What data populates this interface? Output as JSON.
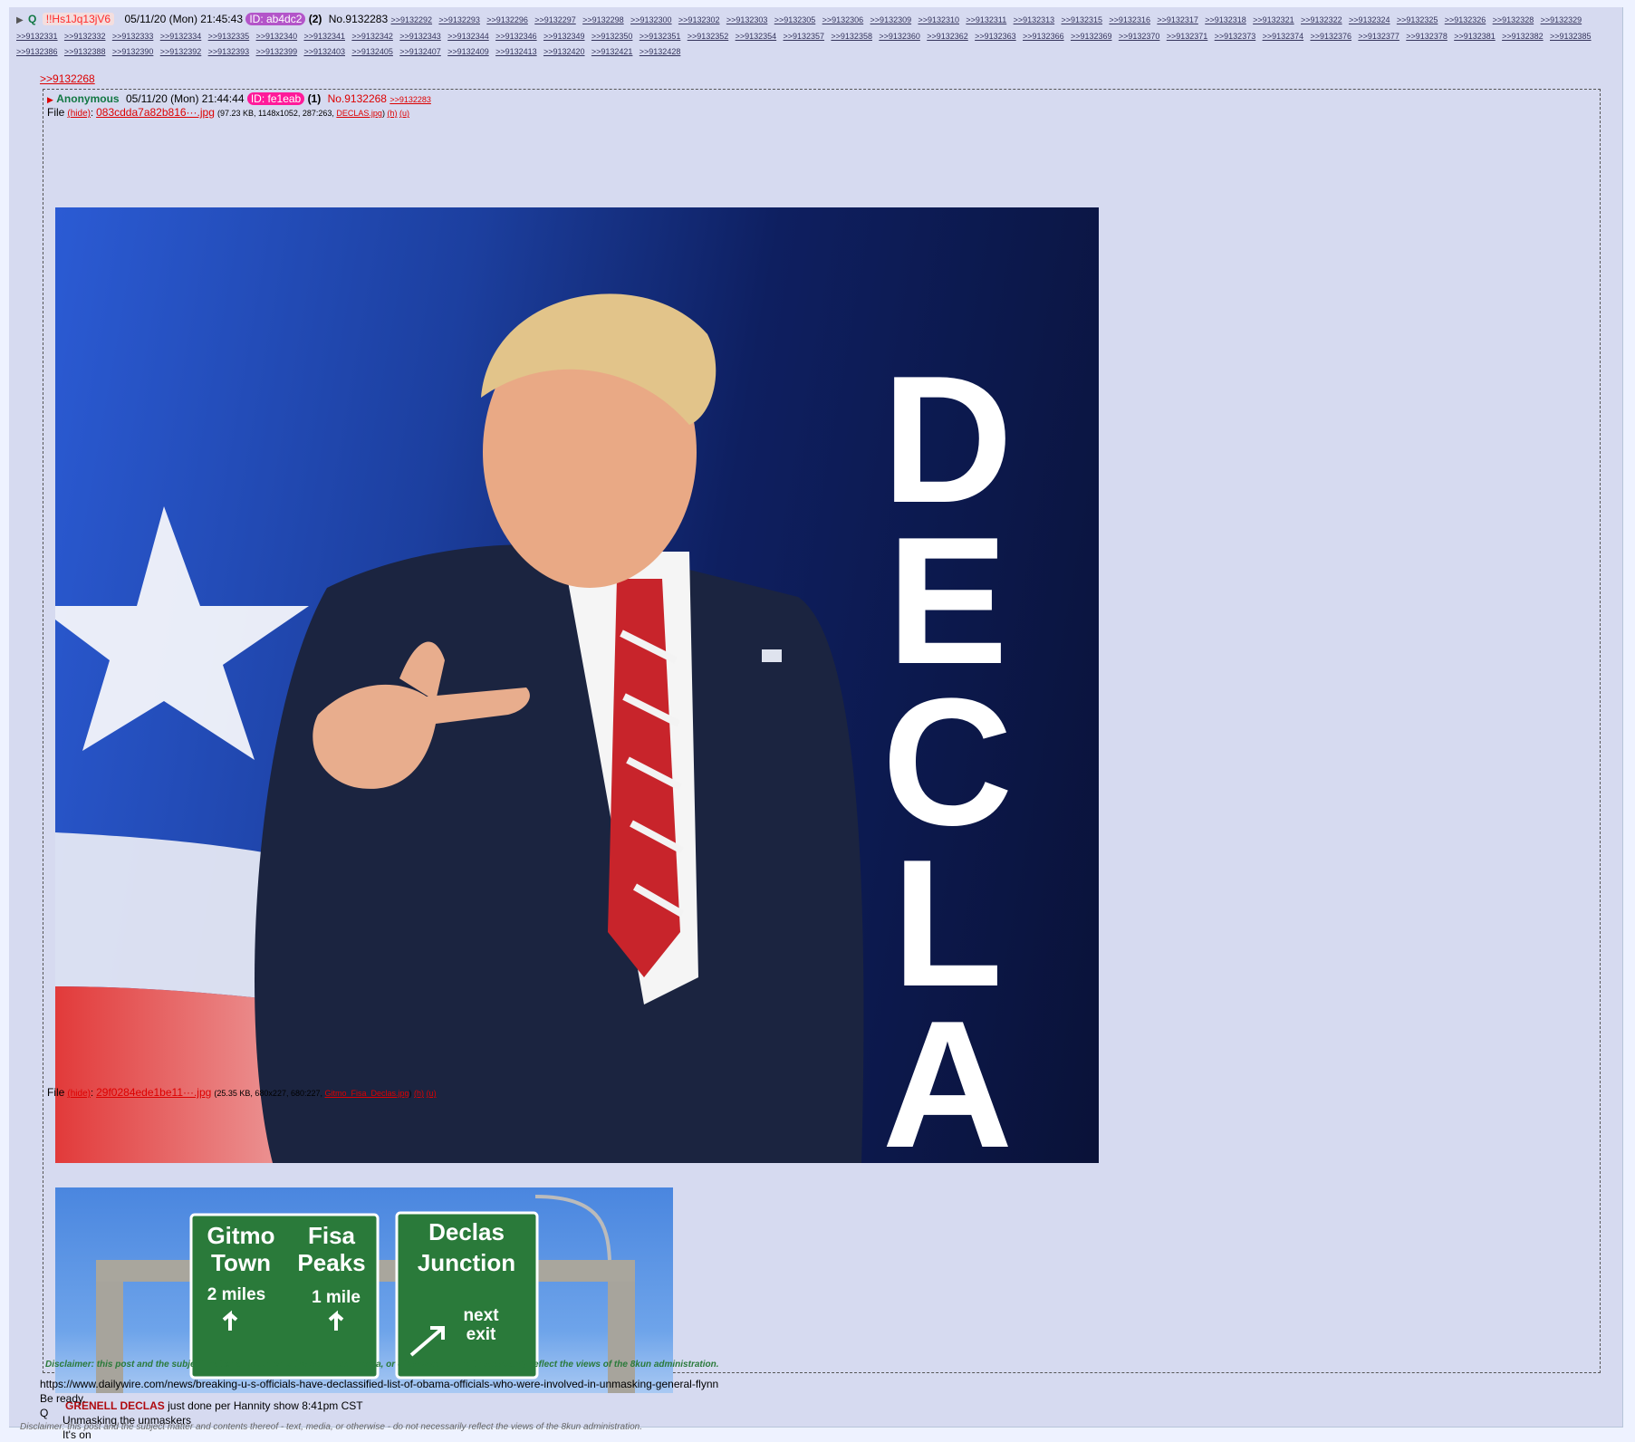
{
  "post": {
    "name": "Q",
    "tripcode": "!!Hs1Jq13jV6",
    "date": "05/11/20 (Mon) 21:45:43",
    "id": "ID: ab4dc2",
    "id_count": "(2)",
    "number": "No.9132283",
    "replies": [
      ">>9132292",
      ">>9132293",
      ">>9132296",
      ">>9132297",
      ">>9132298",
      ">>9132300",
      ">>9132302",
      ">>9132303",
      ">>9132305",
      ">>9132306",
      ">>9132309",
      ">>9132310",
      ">>9132311",
      ">>9132313",
      ">>9132315",
      ">>9132316",
      ">>9132317",
      ">>9132318",
      ">>9132321",
      ">>9132322",
      ">>9132324",
      ">>9132325",
      ">>9132326",
      ">>9132328",
      ">>9132329",
      ">>9132331",
      ">>9132332",
      ">>9132333",
      ">>9132334",
      ">>9132335",
      ">>9132340",
      ">>9132341",
      ">>9132342",
      ">>9132343",
      ">>9132344",
      ">>9132346",
      ">>9132349",
      ">>9132350",
      ">>9132351",
      ">>9132352",
      ">>9132354",
      ">>9132357",
      ">>9132358",
      ">>9132360",
      ">>9132362",
      ">>9132363",
      ">>9132366",
      ">>9132369",
      ">>9132370",
      ">>9132371",
      ">>9132373",
      ">>9132374",
      ">>9132376",
      ">>9132377",
      ">>9132378",
      ">>9132381",
      ">>9132382",
      ">>9132385",
      ">>9132386",
      ">>9132388",
      ">>9132390",
      ">>9132392",
      ">>9132393",
      ">>9132399",
      ">>9132403",
      ">>9132405",
      ">>9132407",
      ">>9132409",
      ">>9132413",
      ">>9132420",
      ">>9132421",
      ">>9132428"
    ],
    "quote_link": ">>9132268",
    "body_lines": [
      "https://www.dailywire.com/news/breaking-u-s-officials-have-declassified-list-of-obama-officials-who-were-involved-in-unmasking-general-flynn",
      "Be ready.",
      "Q"
    ],
    "disclaimer": "Disclaimer: this post and the subject matter and contents thereof - text, media, or otherwise - do not necessarily reflect the views of the 8kun administration."
  },
  "quoted": {
    "name": "Anonymous",
    "date": "05/11/20 (Mon) 21:44:44",
    "id": "ID: fe1eab",
    "id_count": "(1)",
    "number": "No.9132268",
    "backlink": ">>9132283",
    "files": [
      {
        "label": "File",
        "hide": "(hide)",
        "name": "083cdda7a82b816···.jpg",
        "meta_size": "(97.23 KB, 1148x1052, 287:263,",
        "orig_name": "DECLAS.jpg",
        "h": "(h)",
        "u": "(u)",
        "image_text": "DECLAS"
      },
      {
        "label": "File",
        "hide": "(hide)",
        "name": "29f0284ede1be11···.jpg",
        "meta_size": "(25.35 KB, 680x227, 680:227,",
        "orig_name": "Gitmo_Fisa_Declas.jpg",
        "h": "(h)",
        "u": "(u)",
        "signs": {
          "s1a": "Gitmo",
          "s1b": "Town",
          "s1c": "2 miles",
          "s2a": "Fisa",
          "s2b": "Peaks",
          "s2c": "1 mile",
          "s3a": "Declas",
          "s3b": "Junction",
          "s3c": "next",
          "s3d": "exit"
        }
      }
    ],
    "body_lead": "GRENELL DECLAS",
    "body_lead_rest": " just done per Hannity show 8:41pm CST",
    "body_lines": [
      "Unmasking the unmaskers",
      "It's on"
    ],
    "disclaimer": "Disclaimer: this post and the subject matter and contents thereof - text, media, or otherwise - do not necessarily reflect the views of the 8kun administration."
  }
}
